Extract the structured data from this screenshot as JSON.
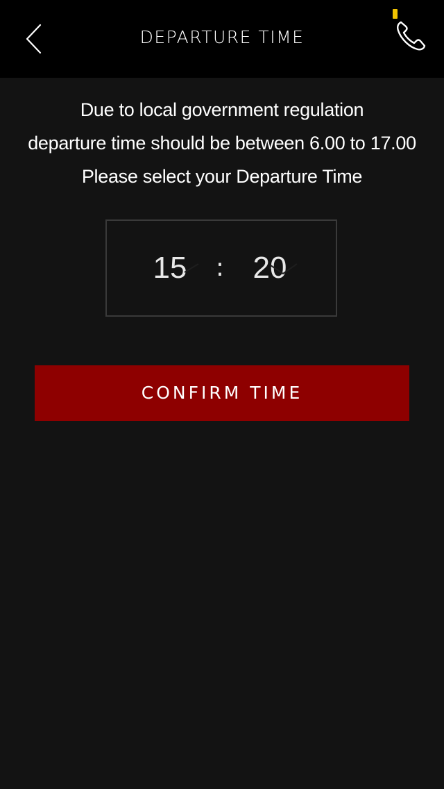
{
  "header": {
    "title": "DEPARTURE TIME",
    "back_icon": "chevron-left-icon",
    "call_icon": "phone-icon",
    "status_color": "#f2c300"
  },
  "notice": {
    "line1": "Due to local government regulation",
    "line2": "departure time should be between 6.00 to 17.00",
    "line3": "Please select your Departure Time"
  },
  "time_picker": {
    "hour": "15",
    "separator": ":",
    "minute": "20"
  },
  "confirm": {
    "label": "CONFIRM TIME",
    "color": "#8e0000"
  },
  "colors": {
    "background": "#131313",
    "header": "#000000"
  }
}
